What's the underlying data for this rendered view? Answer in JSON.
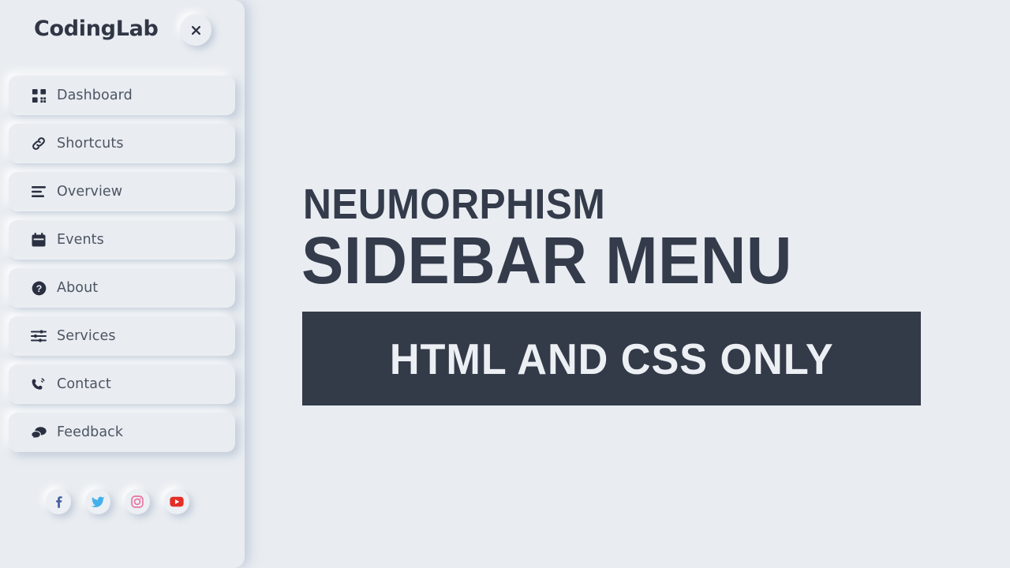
{
  "brand": {
    "name": "CodingLab",
    "close_label": "×"
  },
  "sidebar": {
    "items": [
      {
        "label": "Dashboard",
        "icon": "grid-dashboard-icon"
      },
      {
        "label": "Shortcuts",
        "icon": "link-chain-icon"
      },
      {
        "label": "Overview",
        "icon": "list-lines-icon"
      },
      {
        "label": "Events",
        "icon": "calendar-icon"
      },
      {
        "label": "About",
        "icon": "question-circle-icon"
      },
      {
        "label": "Services",
        "icon": "sliders-icon"
      },
      {
        "label": "Contact",
        "icon": "phone-ring-icon"
      },
      {
        "label": "Feedback",
        "icon": "chat-bubbles-icon"
      }
    ],
    "social": [
      {
        "name": "facebook",
        "icon": "facebook-icon",
        "color": "#4460a0"
      },
      {
        "name": "twitter",
        "icon": "twitter-icon",
        "color": "#44b0ea"
      },
      {
        "name": "instagram",
        "icon": "instagram-icon",
        "color": "#e86a9a"
      },
      {
        "name": "youtube",
        "icon": "youtube-icon",
        "color": "#e52d27"
      }
    ]
  },
  "main": {
    "headline_top": "NEUMORPHISM",
    "headline_main": "SIDEBAR MENU",
    "banner_text": "HTML AND CSS ONLY"
  },
  "colors": {
    "background": "#e9edf1",
    "text_dark": "#343b4b",
    "text_menu": "#4d5463",
    "banner_bg": "#333a48",
    "banner_text": "#eceff3"
  }
}
